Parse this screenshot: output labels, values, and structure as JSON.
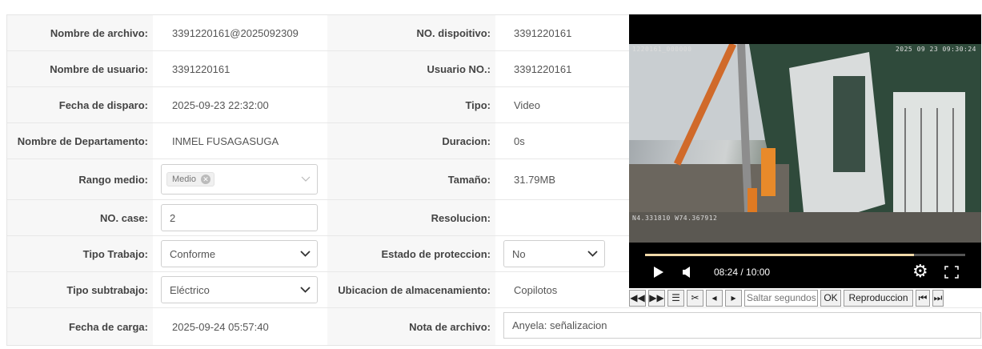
{
  "fields": {
    "nombre_archivo": {
      "label": "Nombre de archivo:",
      "value": "3391220161@2025092309"
    },
    "nombre_usuario": {
      "label": "Nombre de usuario:",
      "value": "3391220161"
    },
    "fecha_disparo": {
      "label": "Fecha de disparo:",
      "value": "2025-09-23 22:32:00"
    },
    "departamento": {
      "label": "Nombre de Departamento:",
      "value": "INMEL FUSAGASUGA"
    },
    "rango_medio": {
      "label": "Rango medio:",
      "tag": "Medio"
    },
    "no_case": {
      "label": "NO. case:",
      "value": "2"
    },
    "tipo_trabajo": {
      "label": "Tipo Trabajo:",
      "value": "Conforme"
    },
    "tipo_subtrabajo": {
      "label": "Tipo subtrabajo:",
      "value": "Eléctrico"
    },
    "fecha_carga": {
      "label": "Fecha de carga:",
      "value": "2025-09-24 05:57:40"
    },
    "no_dispositivo": {
      "label": "NO. dispoitivo:",
      "value": "3391220161"
    },
    "usuario_no": {
      "label": "Usuario NO.:",
      "value": "3391220161"
    },
    "tipo": {
      "label": "Tipo:",
      "value": "Video"
    },
    "duracion": {
      "label": "Duracion:",
      "value": "0s"
    },
    "tamano": {
      "label": "Tamaño:",
      "value": "31.79MB"
    },
    "resolucion": {
      "label": "Resolucion:",
      "value": ""
    },
    "estado_proteccion": {
      "label": "Estado de proteccion:",
      "value": "No"
    },
    "ubicacion": {
      "label": "Ubicacion de almacenamiento:",
      "value": "Copilotos"
    },
    "nota_archivo": {
      "label": "Nota de archivo:",
      "value": "Anyela: señalizacion"
    }
  },
  "video": {
    "osd_id": "1220161_000000",
    "osd_time": "2025 09 23 09:30:24",
    "osd_gps": "N4.331810 W74.367912",
    "time_display": "08:24 / 10:00",
    "progress_fraction": 0.84
  },
  "toolbar": {
    "skip_placeholder": "Saltar segundos",
    "ok_label": "OK",
    "play_label": "Reproduccion"
  }
}
